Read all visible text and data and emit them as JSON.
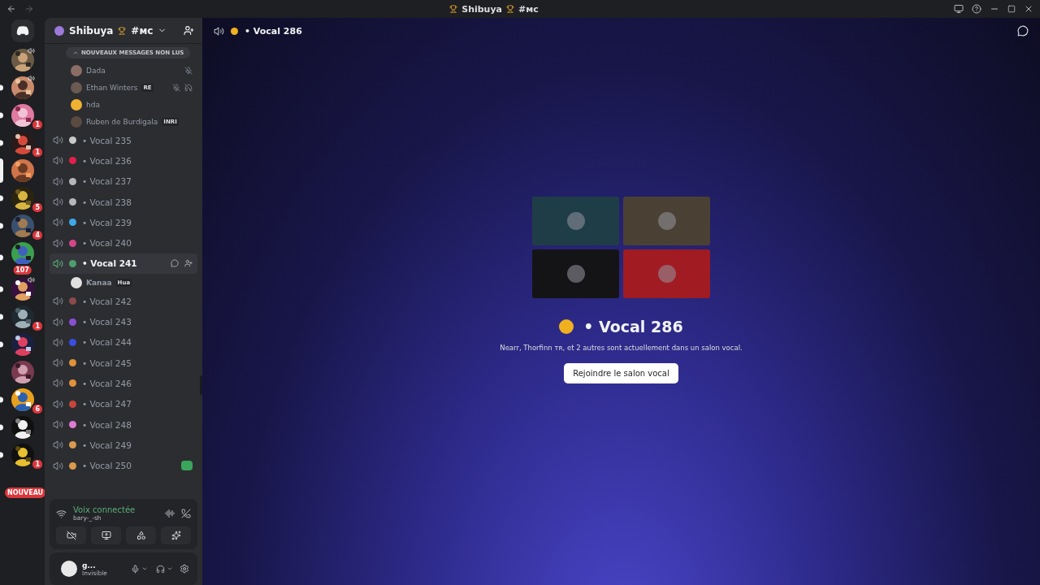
{
  "titlebar": {
    "title": "Shibuya",
    "tag": "#ᴍᴄ"
  },
  "servers": [
    {
      "unread": false,
      "selected": false,
      "voice": true
    },
    {
      "unread": true,
      "selected": false,
      "voice": true
    },
    {
      "badge": "1",
      "unread": true,
      "selected": false,
      "voice": false
    },
    {
      "badge": "1",
      "unread": true,
      "selected": false,
      "voice": false
    },
    {
      "unread": false,
      "selected": true,
      "voice": false
    },
    {
      "badge": "5",
      "unread": true,
      "selected": false,
      "voice": false
    },
    {
      "badge": "4",
      "unread": true,
      "selected": false,
      "voice": false
    },
    {
      "badge": "107",
      "unread": true,
      "selected": false,
      "voice": false
    },
    {
      "unread": true,
      "selected": false,
      "voice": true
    },
    {
      "badge": "1",
      "unread": true,
      "selected": false,
      "voice": false
    },
    {
      "unread": true,
      "selected": false,
      "voice": false
    },
    {
      "unread": false,
      "selected": false,
      "voice": false
    },
    {
      "badge": "6",
      "unread": true,
      "selected": false,
      "voice": false
    },
    {
      "unread": true,
      "selected": false,
      "voice": false
    },
    {
      "badge": "1",
      "unread": true,
      "selected": false,
      "voice": false
    }
  ],
  "new_pill": "NOUVEAU",
  "server_header": {
    "name": "Shibuya",
    "tag": "#ᴍᴄ"
  },
  "unread_bar": "NOUVEAUX MESSAGES NON LUS",
  "voice_members": [
    {
      "name": "Dada",
      "muted": true,
      "deafened": false
    },
    {
      "name": "Ethan Winters",
      "tag": "RE",
      "muted": true,
      "deafened": true
    },
    {
      "name": "hda",
      "muted": false,
      "deafened": false
    },
    {
      "name": "Ruben de Burdigala",
      "tag": "INRI",
      "muted": false,
      "deafened": false
    }
  ],
  "channels": [
    {
      "name": "• Vocal 235",
      "color": "#c9c9c9",
      "selected": false,
      "activity": false
    },
    {
      "name": "• Vocal 236",
      "color": "#e0204a",
      "selected": false,
      "activity": false
    },
    {
      "name": "• Vocal 237",
      "color": "#b5b7bb",
      "selected": false,
      "activity": false
    },
    {
      "name": "• Vocal 238",
      "color": "#b5b7bb",
      "selected": false,
      "activity": false
    },
    {
      "name": "• Vocal 239",
      "color": "#3fa9e8",
      "selected": false,
      "activity": false
    },
    {
      "name": "• Vocal 240",
      "color": "#d5468a",
      "selected": false,
      "activity": false
    },
    {
      "name": "• Vocal 241",
      "color": "#4d9e6c",
      "selected": true,
      "activity": false,
      "members": [
        {
          "name": "Ƙanaa",
          "tag": "Hua"
        }
      ]
    },
    {
      "name": "• Vocal 242",
      "color": "#8c4a4a",
      "selected": false,
      "activity": false
    },
    {
      "name": "• Vocal 243",
      "color": "#8a4fd0",
      "selected": false,
      "activity": false
    },
    {
      "name": "• Vocal 244",
      "color": "#3b4de0",
      "selected": false,
      "activity": false
    },
    {
      "name": "• Vocal 245",
      "color": "#e0913a",
      "selected": false,
      "activity": false
    },
    {
      "name": "• Vocal 246",
      "color": "#e0913a",
      "selected": false,
      "activity": false
    },
    {
      "name": "• Vocal 247",
      "color": "#c7463a",
      "selected": false,
      "activity": false
    },
    {
      "name": "• Vocal 248",
      "color": "#e07ad0",
      "selected": false,
      "activity": false
    },
    {
      "name": "• Vocal 249",
      "color": "#d99a4e",
      "selected": false,
      "activity": false
    },
    {
      "name": "• Vocal 250",
      "color": "#d99a4e",
      "selected": false,
      "activity": true
    }
  ],
  "voice_panel": {
    "status": "Voix connectée",
    "channel": "bary-_-sh"
  },
  "user": {
    "name": "g...",
    "status": "Invisible"
  },
  "main": {
    "header": "• Vocal 286",
    "tiles": [
      {
        "color": "#1f3d47"
      },
      {
        "color": "#4a4134"
      },
      {
        "color": "#141416"
      },
      {
        "color": "#a01b22"
      }
    ],
    "title": "• Vocal 286",
    "description": "Nearr, Thorfinn ᴛʀ, et 2 autres sont actuellement dans un salon vocal.",
    "join_button": "Rejoindre le salon vocal"
  }
}
